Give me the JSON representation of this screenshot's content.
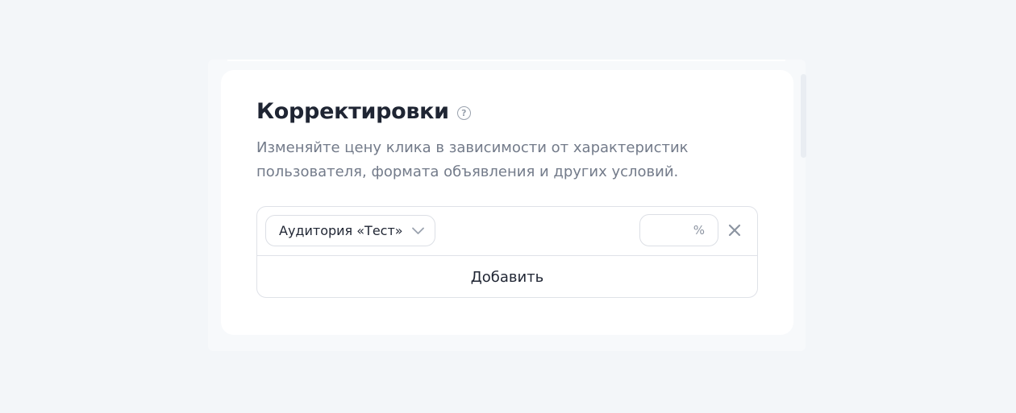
{
  "section": {
    "title": "Корректировки",
    "help_icon": "question-circle-icon",
    "description": "Изменяйте цену клика в зависимости от характеристик пользователя, формата объявления и других условий."
  },
  "adjustments": [
    {
      "audience_label": "Аудитория «Тест»",
      "percent_value": "",
      "percent_sign": "%",
      "remove_icon": "close-icon"
    }
  ],
  "add_button_label": "Добавить",
  "colors": {
    "page_background": "#f3f6f9",
    "card_background": "#ffffff",
    "title_text": "#1f2533",
    "muted_text": "#737b8a",
    "border": "#dfe2e8"
  }
}
